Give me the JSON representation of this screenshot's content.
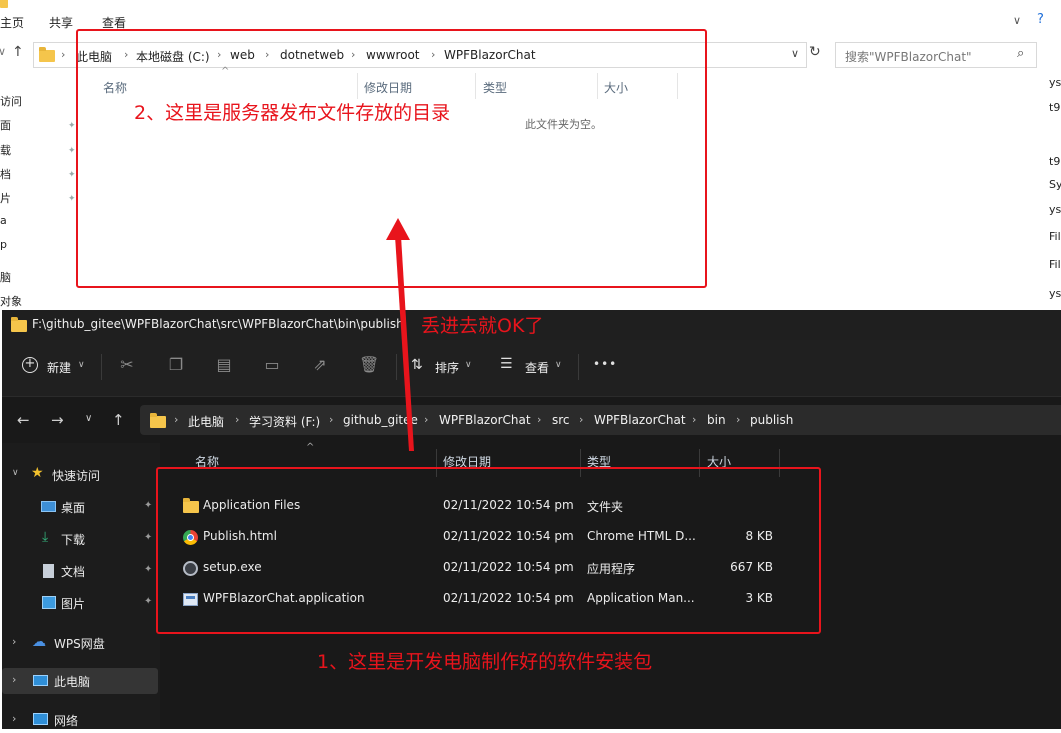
{
  "back_explorer": {
    "ribbon_tabs": [
      "主页",
      "共享",
      "查看"
    ],
    "breadcrumb": [
      "此电脑",
      "本地磁盘 (C:)",
      "web",
      "dotnetweb",
      "wwwroot",
      "WPFBlazorChat"
    ],
    "search_placeholder": "搜索\"WPFBlazorChat\"",
    "columns": [
      "名称",
      "修改日期",
      "类型",
      "大小"
    ],
    "empty_message": "此文件夹为空。",
    "sidebar_fragments": [
      "访问",
      "面",
      "载",
      "档",
      "片",
      "a",
      "p",
      "脑",
      "对象"
    ],
    "right_fragments": [
      "ys",
      "t9",
      "t9",
      "Sy",
      "ys",
      "File",
      "File",
      "ys"
    ]
  },
  "front_explorer": {
    "title": "F:\\github_gitee\\WPFBlazorChat\\src\\WPFBlazorChat\\bin\\publish",
    "toolbar": {
      "new_label": "新建",
      "sort_label": "排序",
      "view_label": "查看",
      "more_label": "•••"
    },
    "breadcrumb": [
      "此电脑",
      "学习资料 (F:)",
      "github_gitee",
      "WPFBlazorChat",
      "src",
      "WPFBlazorChat",
      "bin",
      "publish"
    ],
    "columns": [
      "名称",
      "修改日期",
      "类型",
      "大小"
    ],
    "sidebar": [
      {
        "label": "快速访问",
        "icon": "star-icon"
      },
      {
        "label": "桌面",
        "icon": "desktop-icon"
      },
      {
        "label": "下载",
        "icon": "download-icon"
      },
      {
        "label": "文档",
        "icon": "document-icon"
      },
      {
        "label": "图片",
        "icon": "pictures-icon"
      },
      {
        "label": "WPS网盘",
        "icon": "cloud-icon"
      },
      {
        "label": "此电脑",
        "icon": "pc-icon"
      },
      {
        "label": "网络",
        "icon": "network-icon"
      }
    ],
    "files": [
      {
        "name": "Application Files",
        "date": "02/11/2022 10:54 pm",
        "type": "文件夹",
        "size": "",
        "icon": "folder-icon"
      },
      {
        "name": "Publish.html",
        "date": "02/11/2022 10:54 pm",
        "type": "Chrome HTML D...",
        "size": "8 KB",
        "icon": "chrome-icon"
      },
      {
        "name": "setup.exe",
        "date": "02/11/2022 10:54 pm",
        "type": "应用程序",
        "size": "667 KB",
        "icon": "setup-icon"
      },
      {
        "name": "WPFBlazorChat.application",
        "date": "02/11/2022 10:54 pm",
        "type": "Application Man...",
        "size": "3 KB",
        "icon": "application-manifest-icon"
      }
    ]
  },
  "annotations": {
    "label_server": "2、这里是服务器发布文件存放的目录",
    "label_drop": "丢进去就OK了",
    "label_package": "1、这里是开发电脑制作好的软件安装包",
    "annotation_color": "#e8141c"
  }
}
